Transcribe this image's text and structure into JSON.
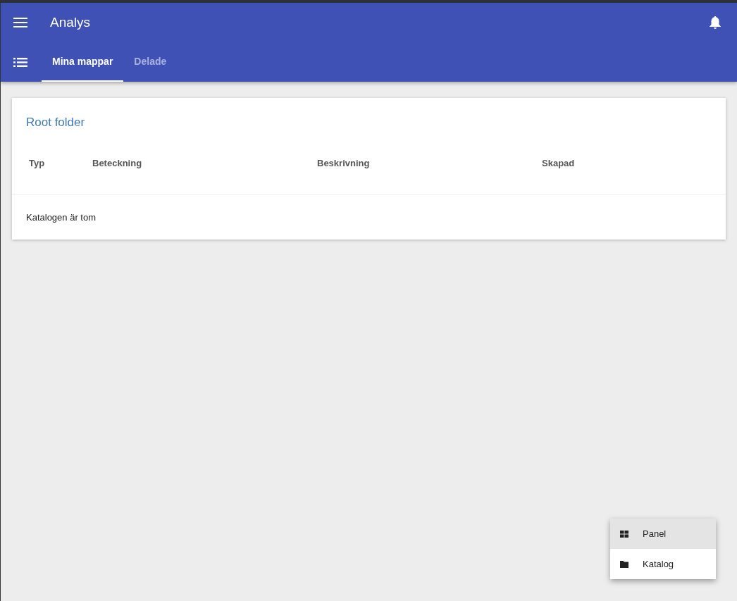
{
  "app_bar": {
    "title": "Analys"
  },
  "tabs": [
    {
      "label": "Mina mappar",
      "selected": true
    },
    {
      "label": "Delade",
      "selected": false
    }
  ],
  "folder": {
    "title": "Root folder",
    "columns": [
      "Typ",
      "Beteckning",
      "Beskrivning",
      "Skapad"
    ],
    "empty_message": "Katalogen är tom"
  },
  "menu": [
    {
      "kind": "panel",
      "label": "Panel",
      "selected": true
    },
    {
      "kind": "folder",
      "label": "Katalog",
      "selected": false
    }
  ]
}
